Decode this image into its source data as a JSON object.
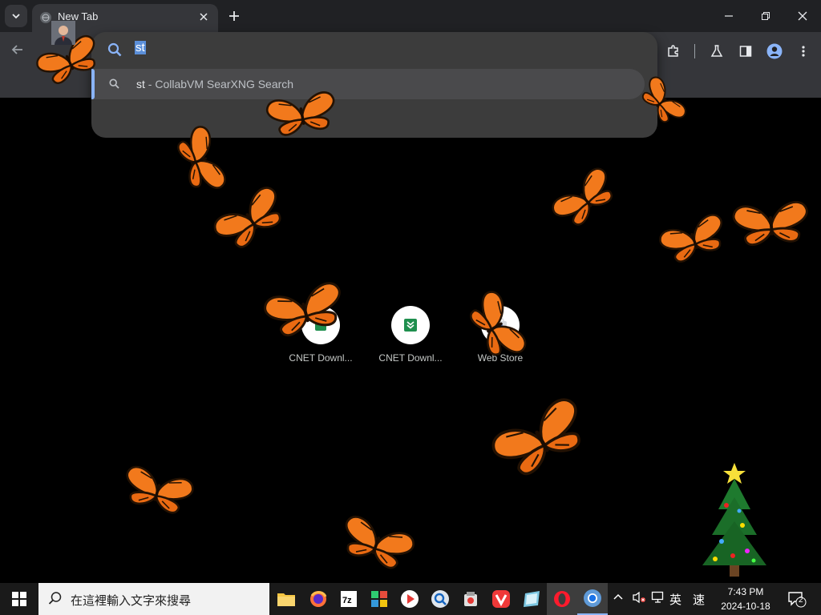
{
  "browser": {
    "tab": {
      "title": "New Tab"
    },
    "omnibox": {
      "input_text": "st",
      "suggestion": {
        "query": "st",
        "separator": " - ",
        "engine": "CollabVM SearXNG Search"
      }
    }
  },
  "ntp": {
    "shortcuts": [
      {
        "label": "CNET Downl...",
        "icon": "cnet-green-icon"
      },
      {
        "label": "CNET Downl...",
        "icon": "download-arrow-icon"
      },
      {
        "label": "Web Store",
        "icon": "web-store-icon"
      }
    ]
  },
  "taskbar": {
    "search_placeholder": "在這裡輸入文字來搜尋",
    "apps": [
      "file-explorer",
      "firefox",
      "7zip",
      "puzzle-app",
      "video-player",
      "search-app",
      "cleaner",
      "vivaldi",
      "notepad",
      "opera",
      "chrome"
    ],
    "tray": {
      "ime_lang": "英",
      "ime_mode": "速",
      "time": "7:43 PM",
      "date": "2024-10-18",
      "notifications": "2"
    }
  },
  "colors": {
    "accent": "#8ab4f8",
    "butterfly": "#f2791c",
    "tab_bg": "#35363a",
    "strip_bg": "#202124"
  }
}
